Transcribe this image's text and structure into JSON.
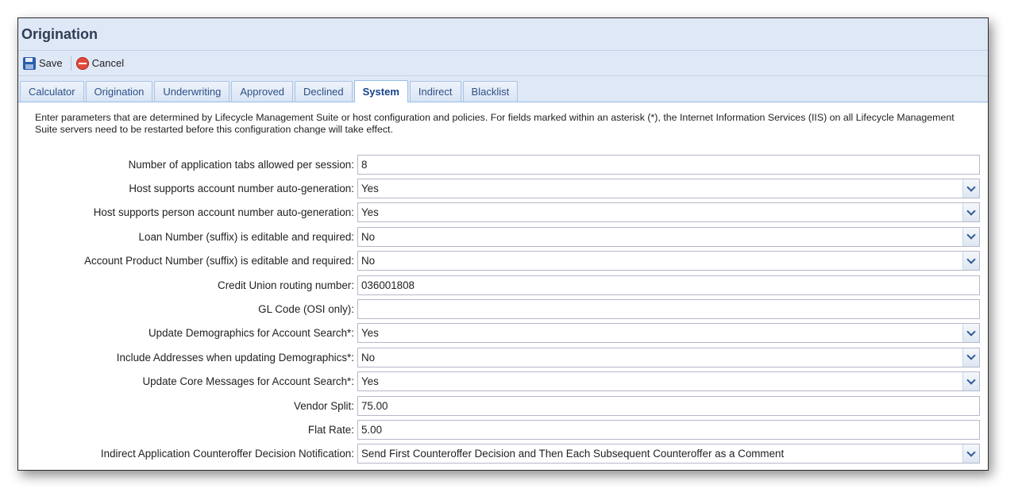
{
  "window": {
    "title": "Origination"
  },
  "toolbar": {
    "save_label": "Save",
    "cancel_label": "Cancel"
  },
  "tabs": [
    {
      "label": "Calculator",
      "active": false
    },
    {
      "label": "Origination",
      "active": false
    },
    {
      "label": "Underwriting",
      "active": false
    },
    {
      "label": "Approved",
      "active": false
    },
    {
      "label": "Declined",
      "active": false
    },
    {
      "label": "System",
      "active": true
    },
    {
      "label": "Indirect",
      "active": false
    },
    {
      "label": "Blacklist",
      "active": false
    }
  ],
  "description": "Enter parameters that are determined by Lifecycle Management Suite or host configuration and policies. For fields marked within an asterisk (*), the Internet Information Services (IIS) on all Lifecycle Management Suite servers need to be restarted before this configuration change will take effect.",
  "fields": [
    {
      "label": "Number of application tabs allowed per session:",
      "value": "8",
      "type": "text"
    },
    {
      "label": "Host supports account number auto-generation:",
      "value": "Yes",
      "type": "select"
    },
    {
      "label": "Host supports person account number auto-generation:",
      "value": "Yes",
      "type": "select"
    },
    {
      "label": "Loan Number (suffix) is editable and required:",
      "value": "No",
      "type": "select"
    },
    {
      "label": "Account Product Number (suffix) is editable and required:",
      "value": "No",
      "type": "select"
    },
    {
      "label": "Credit Union routing number:",
      "value": "036001808",
      "type": "text"
    },
    {
      "label": "GL Code (OSI only):",
      "value": "",
      "type": "text"
    },
    {
      "label": "Update Demographics for Account Search*:",
      "value": "Yes",
      "type": "select"
    },
    {
      "label": "Include Addresses when updating Demographics*:",
      "value": "No",
      "type": "select"
    },
    {
      "label": "Update Core Messages for Account Search*:",
      "value": "Yes",
      "type": "select"
    },
    {
      "label": "Vendor Split:",
      "value": "75.00",
      "type": "text"
    },
    {
      "label": "Flat Rate:",
      "value": "5.00",
      "type": "text"
    },
    {
      "label": "Indirect Application Counteroffer Decision Notification:",
      "value": "Send First Counteroffer Decision and Then Each Subsequent Counteroffer as a Comment",
      "type": "select"
    }
  ]
}
